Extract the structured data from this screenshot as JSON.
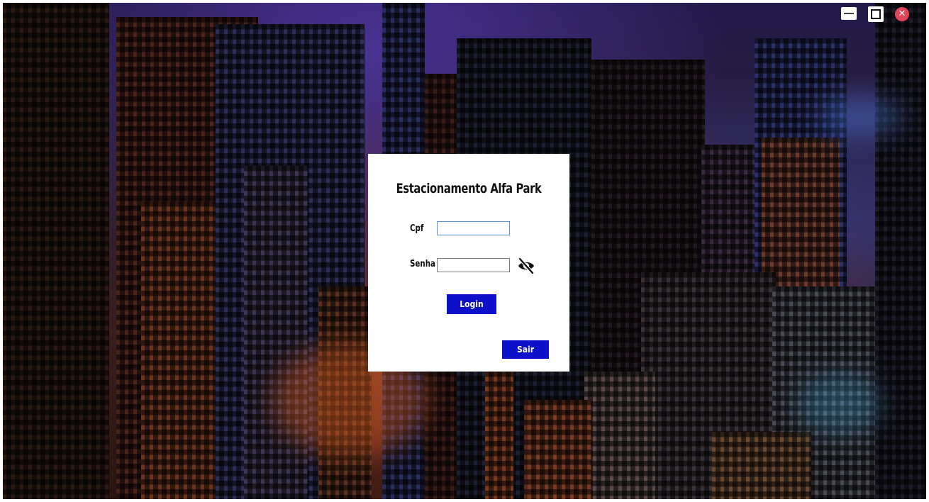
{
  "window": {
    "controls": {
      "minimize_icon": "minimize-icon",
      "maximize_icon": "maximize-icon",
      "close_icon": "close-icon",
      "close_glyph": "✕"
    }
  },
  "login": {
    "title": "Estacionamento Alfa Park",
    "cpf_label": "Cpf",
    "cpf_value": "",
    "senha_label": "Senha",
    "senha_value": "",
    "toggle_icon": "eye-slash-icon",
    "login_button": "Login",
    "exit_button": "Sair"
  },
  "colors": {
    "button": "#0f10c9",
    "card": "#ffffff",
    "close": "#e0455a"
  }
}
